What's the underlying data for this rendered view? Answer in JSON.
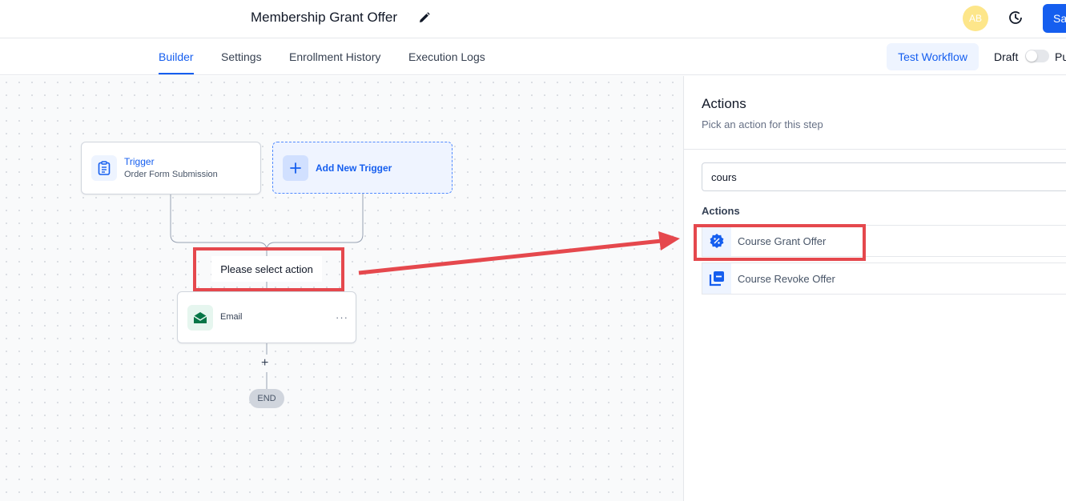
{
  "header": {
    "title": "Membership Grant Offer",
    "avatar_initials": "AB",
    "save_label": "Sa"
  },
  "tabs": [
    {
      "label": "Builder",
      "active": true
    },
    {
      "label": "Settings",
      "active": false
    },
    {
      "label": "Enrollment History",
      "active": false
    },
    {
      "label": "Execution Logs",
      "active": false
    }
  ],
  "toolbar": {
    "test_label": "Test Workflow",
    "draft_label": "Draft",
    "publish_label": "Pu",
    "published": false
  },
  "canvas": {
    "trigger": {
      "title": "Trigger",
      "subtitle": "Order Form Submission",
      "icon": "clipboard-icon"
    },
    "add_trigger": {
      "label": "Add New Trigger",
      "icon": "plus-icon"
    },
    "pending_action": {
      "label": "Please select action"
    },
    "email_node": {
      "label": "Email",
      "icon": "envelope-open-icon",
      "menu": "···"
    },
    "add_step": "+",
    "end_label": "END"
  },
  "panel": {
    "title": "Actions",
    "subtitle": "Pick an action for this step",
    "search_value": "cours",
    "section_label": "Actions",
    "actions": [
      {
        "label": "Course Grant Offer",
        "icon": "discount-badge-icon"
      },
      {
        "label": "Course Revoke Offer",
        "icon": "stacked-cards-icon"
      }
    ]
  },
  "colors": {
    "primary": "#155eef",
    "annotation": "#e5484d",
    "avatar": "#fde68a",
    "email_icon": "#067647"
  }
}
